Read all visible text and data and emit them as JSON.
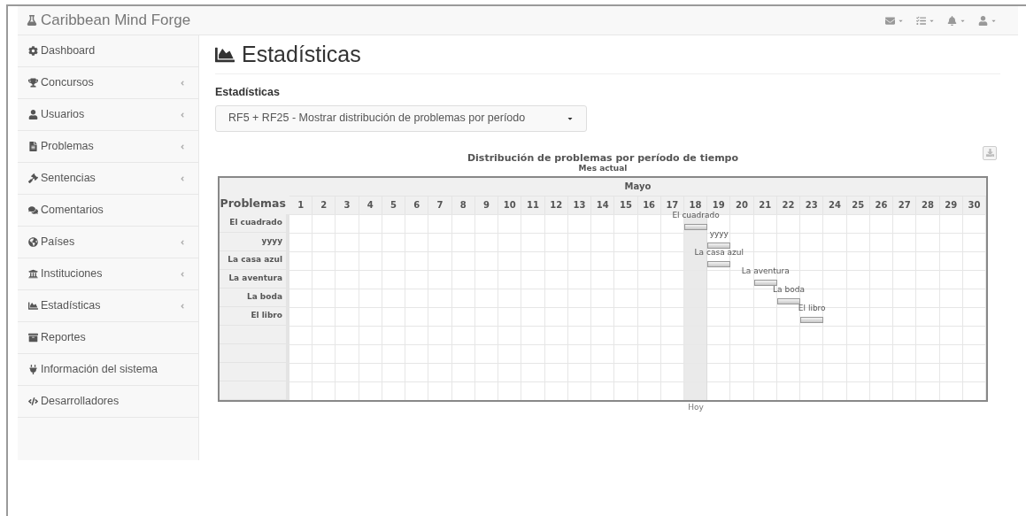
{
  "app": {
    "title": "Caribbean Mind Forge"
  },
  "navbar_menus": [
    {
      "kind": "envelope"
    },
    {
      "kind": "tasks"
    },
    {
      "kind": "bell"
    },
    {
      "kind": "user"
    }
  ],
  "sidebar": {
    "items": [
      {
        "label": "Dashboard",
        "kind": "gear",
        "expandable": false
      },
      {
        "label": "Concursos",
        "kind": "trophy",
        "expandable": true
      },
      {
        "label": "Usuarios",
        "kind": "user",
        "expandable": true
      },
      {
        "label": "Problemas",
        "kind": "file",
        "expandable": true
      },
      {
        "label": "Sentencias",
        "kind": "gavel",
        "expandable": true
      },
      {
        "label": "Comentarios",
        "kind": "comments",
        "expandable": false
      },
      {
        "label": "Países",
        "kind": "globe",
        "expandable": true
      },
      {
        "label": "Instituciones",
        "kind": "bank",
        "expandable": true
      },
      {
        "label": "Estadísticas",
        "kind": "chart",
        "expandable": true
      },
      {
        "label": "Reportes",
        "kind": "archive",
        "expandable": false
      },
      {
        "label": "Información del sistema",
        "kind": "plug",
        "expandable": false
      },
      {
        "label": "Desarrolladores",
        "kind": "code",
        "expandable": false
      }
    ]
  },
  "page": {
    "title": "Estadísticas",
    "select": {
      "label": "Estadísticas",
      "value": "RF5 + RF25 - Mostrar distribución de problemas por período"
    }
  },
  "chart": {
    "title": "Distribución de problemas por período de tiempo",
    "subtitle": "Mes actual",
    "month": "Mayo",
    "row_header": "Problemas",
    "today_label": "Hoy",
    "rows": [
      "El cuadrado",
      "yyyy",
      "La casa azul",
      "La aventura",
      "La boda",
      "El libro"
    ],
    "days": [
      {
        "label": "1",
        "today": false
      },
      {
        "label": "2",
        "today": false
      },
      {
        "label": "3",
        "today": false
      },
      {
        "label": "4",
        "today": false
      },
      {
        "label": "5",
        "today": false
      },
      {
        "label": "6",
        "today": false
      },
      {
        "label": "7",
        "today": false
      },
      {
        "label": "8",
        "today": false
      },
      {
        "label": "9",
        "today": false
      },
      {
        "label": "10",
        "today": false
      },
      {
        "label": "11",
        "today": false
      },
      {
        "label": "12",
        "today": false
      },
      {
        "label": "13",
        "today": false
      },
      {
        "label": "14",
        "today": false
      },
      {
        "label": "15",
        "today": false
      },
      {
        "label": "16",
        "today": false
      },
      {
        "label": "17",
        "today": false
      },
      {
        "label": "18",
        "today": true,
        "bars": [
          "El cuadrado"
        ]
      },
      {
        "label": "19",
        "today": false,
        "bars": [
          "yyyy",
          "La casa azul"
        ]
      },
      {
        "label": "20",
        "today": false
      },
      {
        "label": "21",
        "today": false,
        "bars": [
          "La aventura"
        ]
      },
      {
        "label": "22",
        "today": false,
        "bars": [
          "La boda"
        ]
      },
      {
        "label": "23",
        "today": false,
        "bars": [
          "El libro"
        ]
      },
      {
        "label": "24",
        "today": false
      },
      {
        "label": "25",
        "today": false
      },
      {
        "label": "26",
        "today": false
      },
      {
        "label": "27",
        "today": false
      },
      {
        "label": "28",
        "today": false
      },
      {
        "label": "29",
        "today": false
      },
      {
        "label": "30",
        "today": false
      }
    ]
  }
}
